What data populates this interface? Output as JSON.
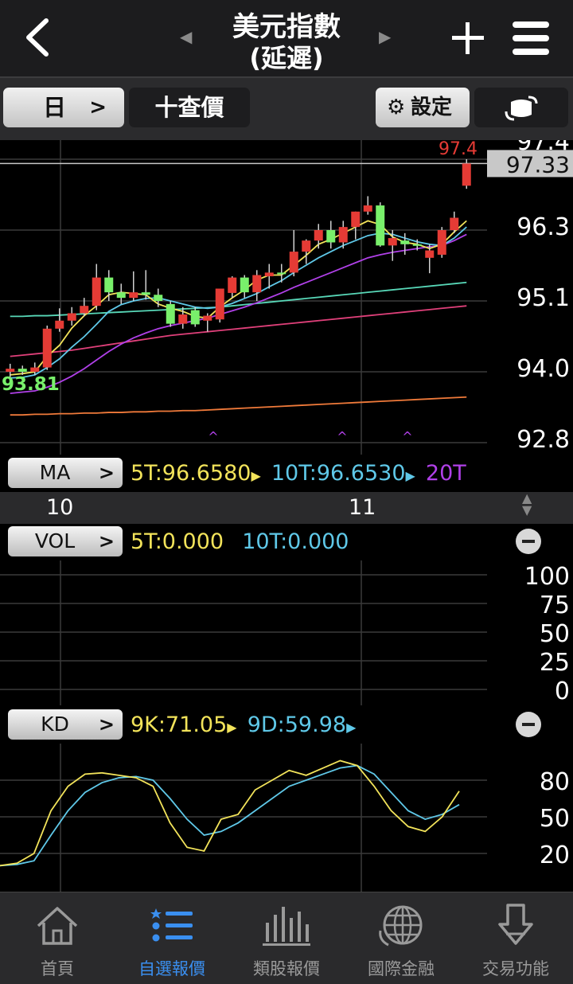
{
  "header": {
    "title": "美元指數",
    "subtitle": "(延遲)"
  },
  "toolbar": {
    "period_label": "日",
    "query_label": "十查價",
    "settings_label": "設定"
  },
  "price_axis": {
    "labels": [
      "97.4",
      "96.3",
      "95.1",
      "94.0",
      "92.8"
    ],
    "current_value": "97.33",
    "high_label": "97.4",
    "low_label": "93.81"
  },
  "ma": {
    "button": "MA",
    "values": [
      "5T:96.6580",
      "10T:96.6530",
      "20T"
    ]
  },
  "date_axis": {
    "labels": [
      "10",
      "11"
    ]
  },
  "vol": {
    "button": "VOL",
    "values": [
      "5T:0.000",
      "10T:0.000"
    ],
    "axis": [
      "100",
      "75",
      "50",
      "25",
      "0"
    ]
  },
  "kd": {
    "button": "KD",
    "values": [
      "9K:71.05",
      "9D:59.98"
    ],
    "axis": [
      "80",
      "50",
      "20"
    ]
  },
  "nav": {
    "items": [
      {
        "label": "首頁",
        "icon": "home-icon",
        "active": false
      },
      {
        "label": "自選報價",
        "icon": "list-icon",
        "active": true
      },
      {
        "label": "類股報價",
        "icon": "bars-icon",
        "active": false
      },
      {
        "label": "國際金融",
        "icon": "globe-icon",
        "active": false
      },
      {
        "label": "交易功能",
        "icon": "down-arrow-icon",
        "active": false
      }
    ]
  },
  "colors": {
    "up": "#e53b35",
    "down": "#79f06b",
    "ma5": "#f2e35a",
    "ma10": "#5fc8e8",
    "ma20": "#b040e8",
    "ma60": "#58d8b8",
    "ma120": "#e0407a",
    "ma240": "#f07a3a",
    "active_nav": "#3a8ff0"
  },
  "chart_data": {
    "type": "candlestick",
    "candles": [
      {
        "o": 93.95,
        "h": 94.08,
        "l": 93.81,
        "c": 94.0
      },
      {
        "o": 94.0,
        "h": 94.05,
        "l": 93.9,
        "c": 93.95
      },
      {
        "o": 93.95,
        "h": 94.1,
        "l": 93.9,
        "c": 94.02
      },
      {
        "o": 94.02,
        "h": 94.7,
        "l": 93.98,
        "c": 94.65
      },
      {
        "o": 94.65,
        "h": 94.98,
        "l": 94.6,
        "c": 94.78
      },
      {
        "o": 94.78,
        "h": 95.0,
        "l": 94.7,
        "c": 94.9
      },
      {
        "o": 94.9,
        "h": 95.15,
        "l": 94.85,
        "c": 95.02
      },
      {
        "o": 95.02,
        "h": 95.7,
        "l": 94.95,
        "c": 95.48
      },
      {
        "o": 95.48,
        "h": 95.6,
        "l": 95.1,
        "c": 95.24
      },
      {
        "o": 95.24,
        "h": 95.38,
        "l": 95.05,
        "c": 95.15
      },
      {
        "o": 95.15,
        "h": 95.58,
        "l": 95.1,
        "c": 95.24
      },
      {
        "o": 95.24,
        "h": 95.6,
        "l": 95.12,
        "c": 95.2
      },
      {
        "o": 95.2,
        "h": 95.3,
        "l": 95.0,
        "c": 95.1
      },
      {
        "o": 95.05,
        "h": 95.1,
        "l": 94.68,
        "c": 94.73
      },
      {
        "o": 94.73,
        "h": 95.0,
        "l": 94.65,
        "c": 94.88
      },
      {
        "o": 94.95,
        "h": 95.0,
        "l": 94.68,
        "c": 94.72
      },
      {
        "o": 94.78,
        "h": 94.9,
        "l": 94.6,
        "c": 94.86
      },
      {
        "o": 94.8,
        "h": 95.15,
        "l": 94.75,
        "c": 95.3
      },
      {
        "o": 95.23,
        "h": 95.5,
        "l": 95.15,
        "c": 95.48
      },
      {
        "o": 95.48,
        "h": 95.52,
        "l": 95.15,
        "c": 95.24
      },
      {
        "o": 95.24,
        "h": 95.6,
        "l": 95.1,
        "c": 95.52
      },
      {
        "o": 95.5,
        "h": 95.7,
        "l": 95.3,
        "c": 95.56
      },
      {
        "o": 95.56,
        "h": 95.7,
        "l": 95.4,
        "c": 95.55
      },
      {
        "o": 95.56,
        "h": 96.25,
        "l": 95.5,
        "c": 95.9
      },
      {
        "o": 95.9,
        "h": 96.1,
        "l": 95.7,
        "c": 96.08
      },
      {
        "o": 96.08,
        "h": 96.35,
        "l": 95.95,
        "c": 96.25
      },
      {
        "o": 96.25,
        "h": 96.4,
        "l": 95.95,
        "c": 96.05
      },
      {
        "o": 96.05,
        "h": 96.4,
        "l": 95.95,
        "c": 96.3
      },
      {
        "o": 96.3,
        "h": 96.55,
        "l": 96.1,
        "c": 96.55
      },
      {
        "o": 96.55,
        "h": 96.8,
        "l": 96.5,
        "c": 96.65
      },
      {
        "o": 96.65,
        "h": 96.7,
        "l": 95.98,
        "c": 96.0
      },
      {
        "o": 96.0,
        "h": 96.25,
        "l": 95.75,
        "c": 96.12
      },
      {
        "o": 96.08,
        "h": 96.2,
        "l": 95.85,
        "c": 96.02
      },
      {
        "o": 96.02,
        "h": 96.1,
        "l": 95.92,
        "c": 96.0
      },
      {
        "o": 95.8,
        "h": 96.02,
        "l": 95.55,
        "c": 95.92
      },
      {
        "o": 95.85,
        "h": 96.3,
        "l": 95.8,
        "c": 96.25
      },
      {
        "o": 96.25,
        "h": 96.55,
        "l": 96.2,
        "c": 96.45
      },
      {
        "o": 96.97,
        "h": 97.4,
        "l": 96.92,
        "c": 97.33
      }
    ],
    "ma5": [
      93.9,
      93.92,
      93.95,
      94.2,
      94.38,
      94.66,
      94.86,
      95.02,
      95.2,
      95.24,
      95.22,
      95.2,
      95.05,
      94.98,
      94.93,
      94.85,
      94.82,
      95.0,
      95.15,
      95.28,
      95.44,
      95.52,
      95.52,
      95.68,
      95.84,
      96.02,
      96.1,
      96.2,
      96.3,
      96.4,
      96.34,
      96.14,
      96.05,
      96.02,
      95.95,
      96.02,
      96.22,
      96.4
    ],
    "ma10": [
      93.85,
      93.86,
      93.9,
      94.02,
      94.16,
      94.35,
      94.52,
      94.72,
      94.93,
      95.04,
      95.1,
      95.14,
      95.15,
      95.1,
      95.05,
      95.0,
      94.98,
      95.0,
      95.06,
      95.14,
      95.22,
      95.33,
      95.43,
      95.56,
      95.68,
      95.8,
      95.9,
      96.0,
      96.08,
      96.16,
      96.2,
      96.18,
      96.12,
      96.06,
      96.02,
      96.0,
      96.12,
      96.3
    ],
    "ma20": [
      93.6,
      93.62,
      93.64,
      93.7,
      93.78,
      93.88,
      94.0,
      94.14,
      94.28,
      94.4,
      94.5,
      94.58,
      94.65,
      94.7,
      94.74,
      94.78,
      94.82,
      94.88,
      94.94,
      95.0,
      95.07,
      95.15,
      95.23,
      95.32,
      95.4,
      95.48,
      95.56,
      95.64,
      95.72,
      95.8,
      95.85,
      95.89,
      95.92,
      95.95,
      95.98,
      96.0,
      96.08,
      96.18
    ],
    "ma60": [
      94.85,
      94.85,
      94.86,
      94.86,
      94.87,
      94.88,
      94.89,
      94.9,
      94.91,
      94.92,
      94.93,
      94.94,
      94.95,
      94.96,
      94.97,
      94.98,
      94.99,
      95.0,
      95.02,
      95.04,
      95.06,
      95.08,
      95.1,
      95.12,
      95.14,
      95.16,
      95.18,
      95.2,
      95.22,
      95.24,
      95.26,
      95.28,
      95.3,
      95.32,
      95.34,
      95.36,
      95.38,
      95.4
    ],
    "ma120": [
      94.2,
      94.22,
      94.24,
      94.26,
      94.28,
      94.3,
      94.33,
      94.36,
      94.39,
      94.42,
      94.45,
      94.48,
      94.51,
      94.54,
      94.56,
      94.58,
      94.6,
      94.62,
      94.64,
      94.66,
      94.68,
      94.7,
      94.72,
      94.74,
      94.76,
      94.78,
      94.8,
      94.82,
      94.84,
      94.86,
      94.88,
      94.9,
      94.92,
      94.94,
      94.96,
      94.98,
      95.0,
      95.02
    ],
    "ma240": [
      93.25,
      93.25,
      93.26,
      93.26,
      93.27,
      93.27,
      93.28,
      93.28,
      93.29,
      93.29,
      93.3,
      93.3,
      93.31,
      93.31,
      93.32,
      93.32,
      93.33,
      93.34,
      93.35,
      93.36,
      93.37,
      93.38,
      93.39,
      93.4,
      93.41,
      93.42,
      93.43,
      93.44,
      93.45,
      93.46,
      93.47,
      93.48,
      93.49,
      93.5,
      93.51,
      93.52,
      93.53,
      93.54
    ],
    "k": [
      10,
      12,
      20,
      55,
      75,
      85,
      86,
      84,
      82,
      75,
      45,
      25,
      22,
      48,
      52,
      72,
      80,
      88,
      84,
      90,
      96,
      92,
      75,
      55,
      42,
      38,
      50,
      71.05
    ],
    "d": [
      10,
      11,
      14,
      35,
      55,
      70,
      78,
      82,
      83,
      80,
      65,
      48,
      35,
      38,
      45,
      55,
      65,
      75,
      80,
      85,
      90,
      92,
      85,
      70,
      55,
      48,
      52,
      59.98
    ],
    "ylim": [
      92.8,
      97.4
    ]
  }
}
